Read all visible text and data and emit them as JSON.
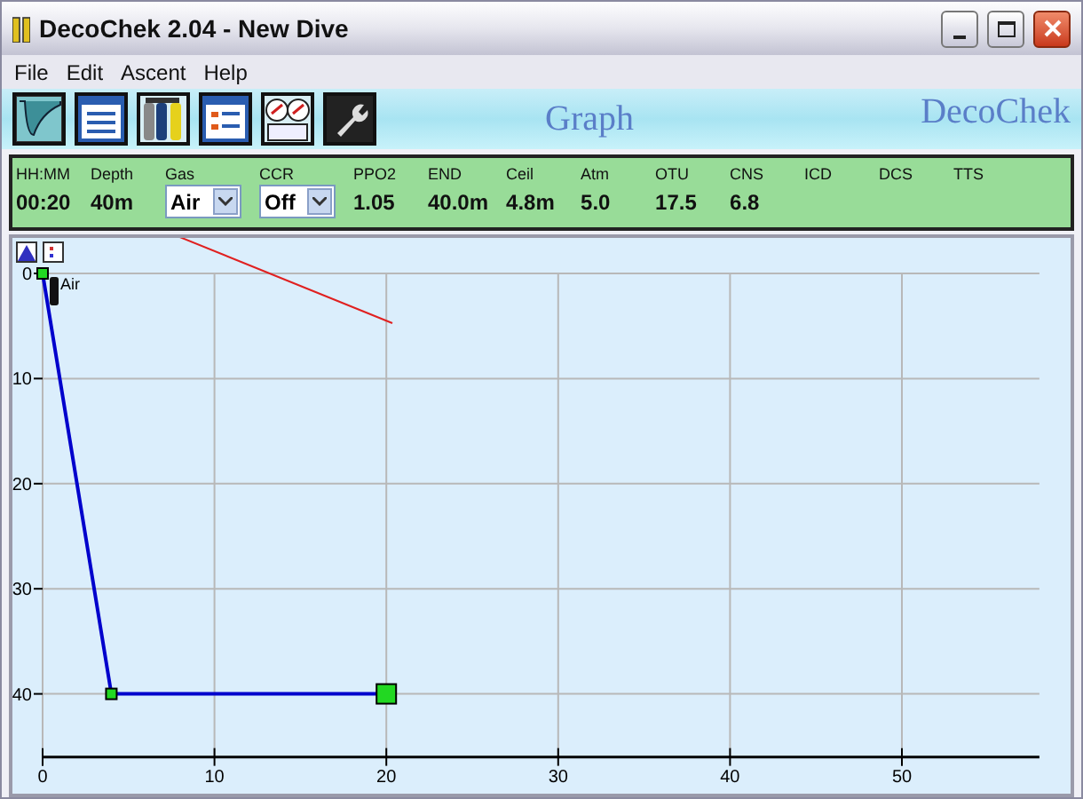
{
  "window": {
    "title": "DecoChek 2.04 - New Dive"
  },
  "menu": [
    "File",
    "Edit",
    "Ascent",
    "Help"
  ],
  "toolbar": {
    "buttons": [
      {
        "kind": "profile"
      },
      {
        "kind": "list"
      },
      {
        "kind": "cylinders"
      },
      {
        "kind": "form"
      },
      {
        "kind": "gauges"
      },
      {
        "kind": "wrench"
      }
    ],
    "view_title": "Graph",
    "brand": "DecoChek"
  },
  "readouts": [
    {
      "label": "HH:MM",
      "value": "00:20",
      "kind": "text"
    },
    {
      "label": "Depth",
      "value": "40m",
      "kind": "text"
    },
    {
      "label": "Gas",
      "value": "Air",
      "kind": "select"
    },
    {
      "label": "CCR",
      "value": "Off",
      "kind": "select"
    },
    {
      "label": "PPO2",
      "value": "1.05",
      "kind": "text"
    },
    {
      "label": "END",
      "value": "40.0m",
      "kind": "text"
    },
    {
      "label": "Ceil",
      "value": "4.8m",
      "kind": "text"
    },
    {
      "label": "Atm",
      "value": "5.0",
      "kind": "text"
    },
    {
      "label": "OTU",
      "value": "17.5",
      "kind": "text"
    },
    {
      "label": "CNS",
      "value": "6.8",
      "kind": "text"
    },
    {
      "label": "ICD",
      "kind": "text"
    },
    {
      "label": "DCS",
      "kind": "text"
    },
    {
      "label": "TTS",
      "kind": "text"
    }
  ],
  "graph": {
    "gas_label": "Air",
    "chart_data": {
      "type": "line",
      "x": [
        0,
        4,
        20
      ],
      "series": [
        {
          "color": "#0000cc",
          "values": [
            0,
            40,
            40
          ],
          "marker": "square"
        }
      ],
      "xticks": [
        0,
        10,
        20,
        30,
        40,
        50
      ],
      "yticks": [
        0,
        10,
        20,
        30,
        40
      ],
      "xlim": [
        0,
        58
      ],
      "ylim": [
        46,
        0
      ],
      "grid": true
    }
  }
}
